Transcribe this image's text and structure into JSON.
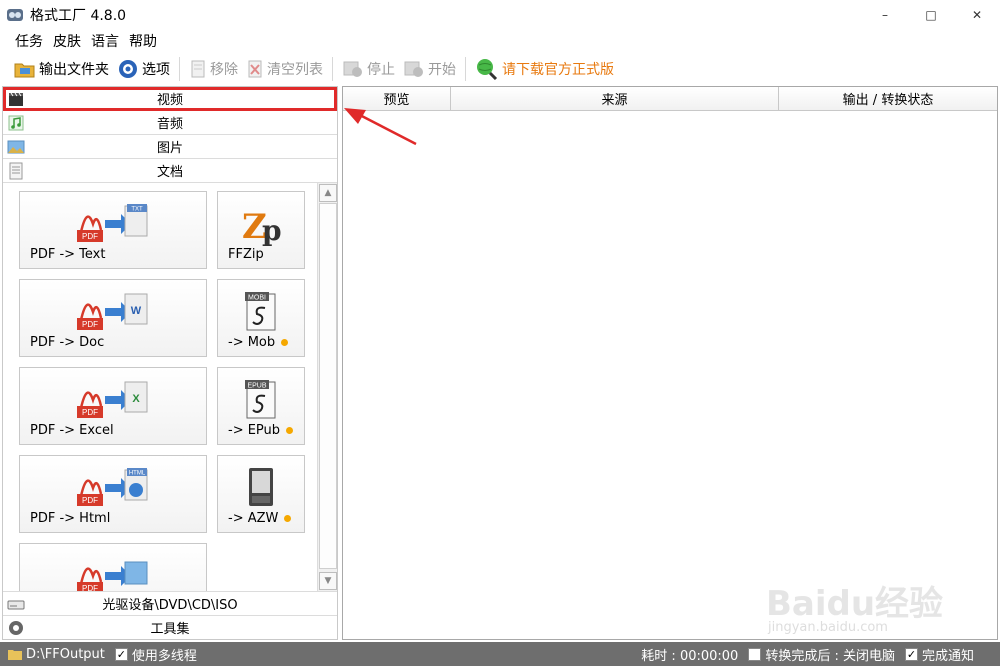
{
  "window": {
    "title": "格式工厂 4.8.0",
    "minimize": "–",
    "maximize": "□",
    "close": "✕"
  },
  "menu": [
    "任务",
    "皮肤",
    "语言",
    "帮助"
  ],
  "toolbar": {
    "output_folder": "输出文件夹",
    "options": "选项",
    "remove": "移除",
    "clear_list": "清空列表",
    "stop": "停止",
    "start": "开始",
    "download_official": "请下载官方正式版"
  },
  "categories": {
    "video": "视频",
    "audio": "音频",
    "image": "图片",
    "document": "文档",
    "optical": "光驱设备\\DVD\\CD\\ISO",
    "toolbox": "工具集"
  },
  "tiles": [
    {
      "label": "PDF -> Text",
      "badge": "TXT"
    },
    {
      "label": "FFZip",
      "badge": ""
    },
    {
      "label": "PDF -> Doc",
      "badge": "W"
    },
    {
      "label": "-> Mob",
      "badge": "MOBI"
    },
    {
      "label": "PDF -> Excel",
      "badge": "X"
    },
    {
      "label": "-> EPub",
      "badge": "EPUB"
    },
    {
      "label": "PDF -> Html",
      "badge": "HTML"
    },
    {
      "label": "-> AZW",
      "badge": ""
    },
    {
      "label": "",
      "badge": ""
    }
  ],
  "pdf_label": "PDF",
  "table": {
    "columns": [
      "预览",
      "来源",
      "输出 / 转换状态"
    ]
  },
  "status": {
    "output_path": "D:\\FFOutput",
    "multithread_label": "使用多线程",
    "elapsed": "耗时 : 00:00:00",
    "after_convert": "转换完成后 : 关闭电脑",
    "notify": "完成通知",
    "check": "✓"
  },
  "watermark": {
    "main": "Baidu经验",
    "sub": "jingyan.baidu.com"
  },
  "colors": {
    "selection_border": "#e02a2a",
    "download_text": "#e87a10",
    "status_bg": "#6e6e6e",
    "badge_dot": "#f5a800"
  }
}
